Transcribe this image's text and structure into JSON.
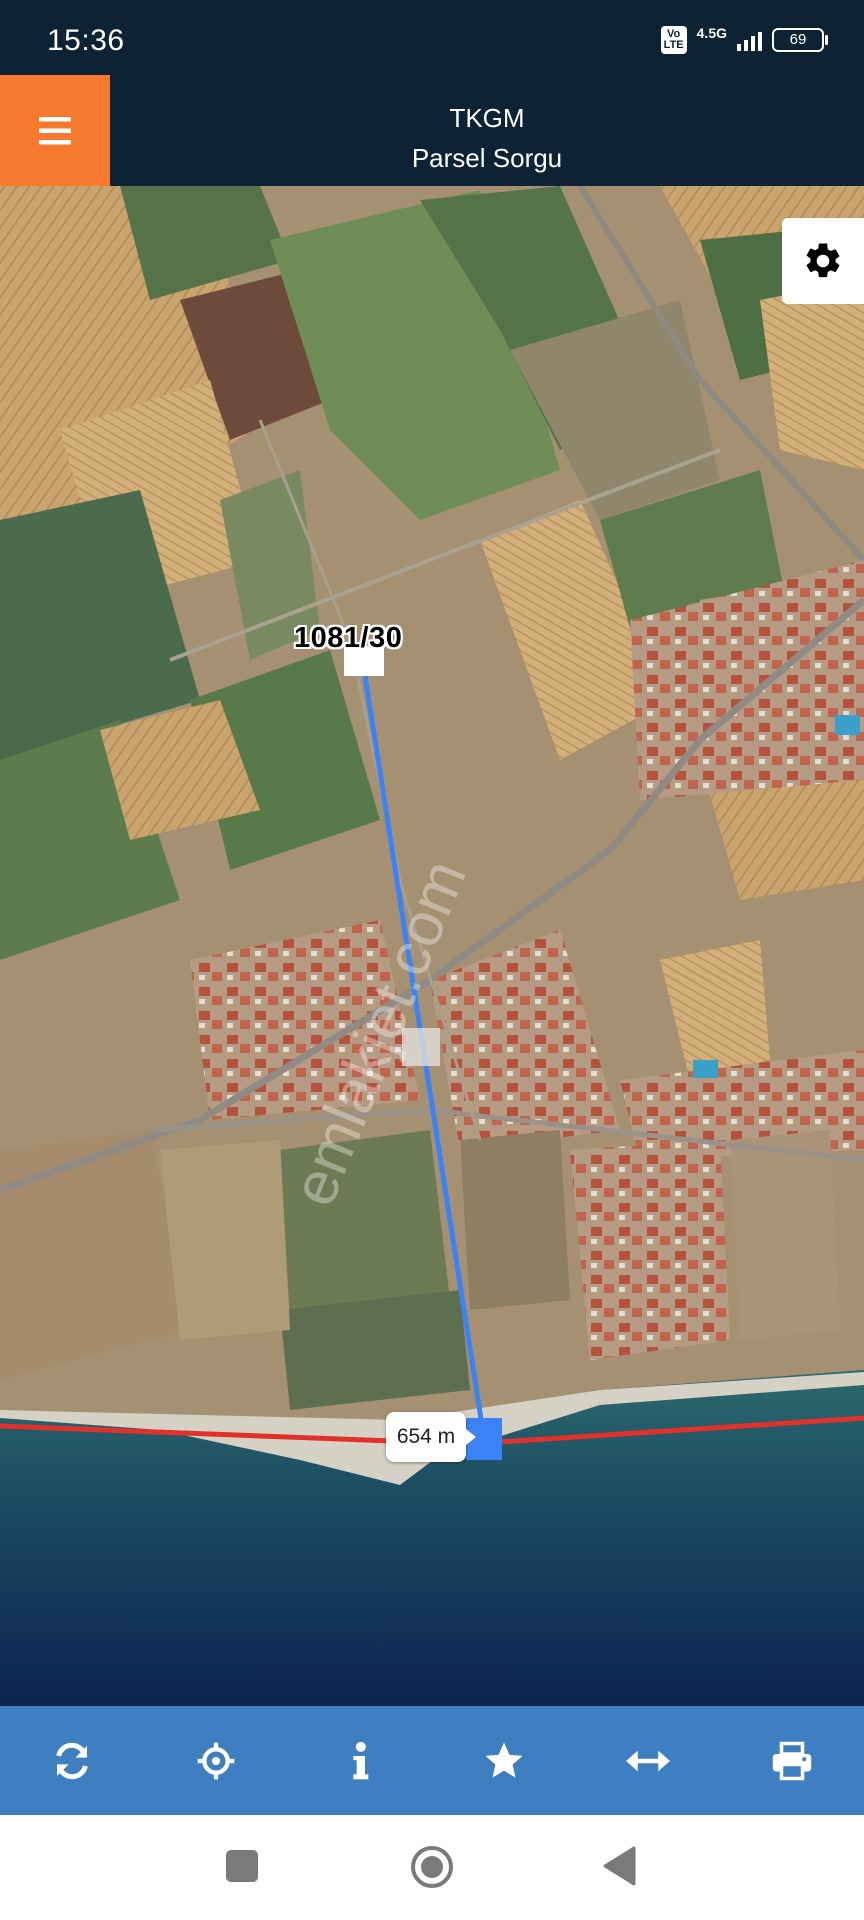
{
  "status_bar": {
    "time": "15:36",
    "volte_badge": "Vo LTE",
    "network": "4.5G",
    "battery": "69"
  },
  "header": {
    "menu_icon": "hamburger-menu-icon",
    "title": "TKGM",
    "subtitle": "Parsel Sorgu"
  },
  "map": {
    "type": "satellite",
    "parcel_label": "1081/30",
    "distance_label": "654 m",
    "watermark": "emlakjet.com",
    "settings_icon": "gear-icon",
    "colors": {
      "measure_line": "#3b82f6",
      "coast_line": "#e0322b"
    }
  },
  "toolbar": {
    "buttons": [
      {
        "name": "refresh",
        "icon": "refresh-icon"
      },
      {
        "name": "locate",
        "icon": "crosshair-icon"
      },
      {
        "name": "info",
        "icon": "info-icon"
      },
      {
        "name": "favorite",
        "icon": "star-icon"
      },
      {
        "name": "measure",
        "icon": "arrows-horizontal-icon"
      },
      {
        "name": "print",
        "icon": "printer-icon"
      }
    ],
    "colors": {
      "background": "#3d7fc1",
      "icon": "#ffffff"
    }
  },
  "nav_bar": {
    "buttons": [
      "recent-apps",
      "home",
      "back"
    ]
  }
}
